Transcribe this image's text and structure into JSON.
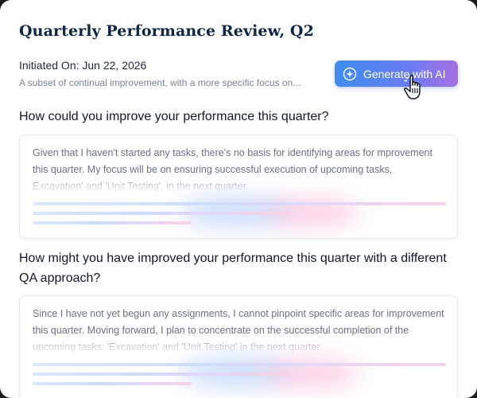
{
  "header": {
    "title": "Quarterly Performance Review, Q2",
    "initiated": "Initiated On: Jun 22, 2026",
    "subtitle": "A subset of continual improvement, with a more specific focus on..."
  },
  "generate_button": {
    "label": "Generate with AI",
    "icon": "sparkle-compass-icon"
  },
  "questions": [
    {
      "question": "How could you improve your performance this quarter?",
      "answer": "Given that I haven't started any tasks, there's no basis for identifying areas for mprovement this quarter. My focus will be on ensuring successful execution of upcoming tasks, Excavation' and 'Unit Testing', in the next quarter."
    },
    {
      "question": "How might you have improved your performance this quarter with a different QA approach?",
      "answer": "Since I have not yet begun any assignments, I cannot pinpoint specific areas for improvement this quarter. Moving forward, I plan to concentrate on the successful completion of the upcoming tasks: 'Excavation' and 'Unit Testing' in the next quarter."
    }
  ],
  "colors": {
    "title": "#0f2544",
    "button_gradient_start": "#3f8cf0",
    "button_gradient_end": "#a66ee3"
  }
}
